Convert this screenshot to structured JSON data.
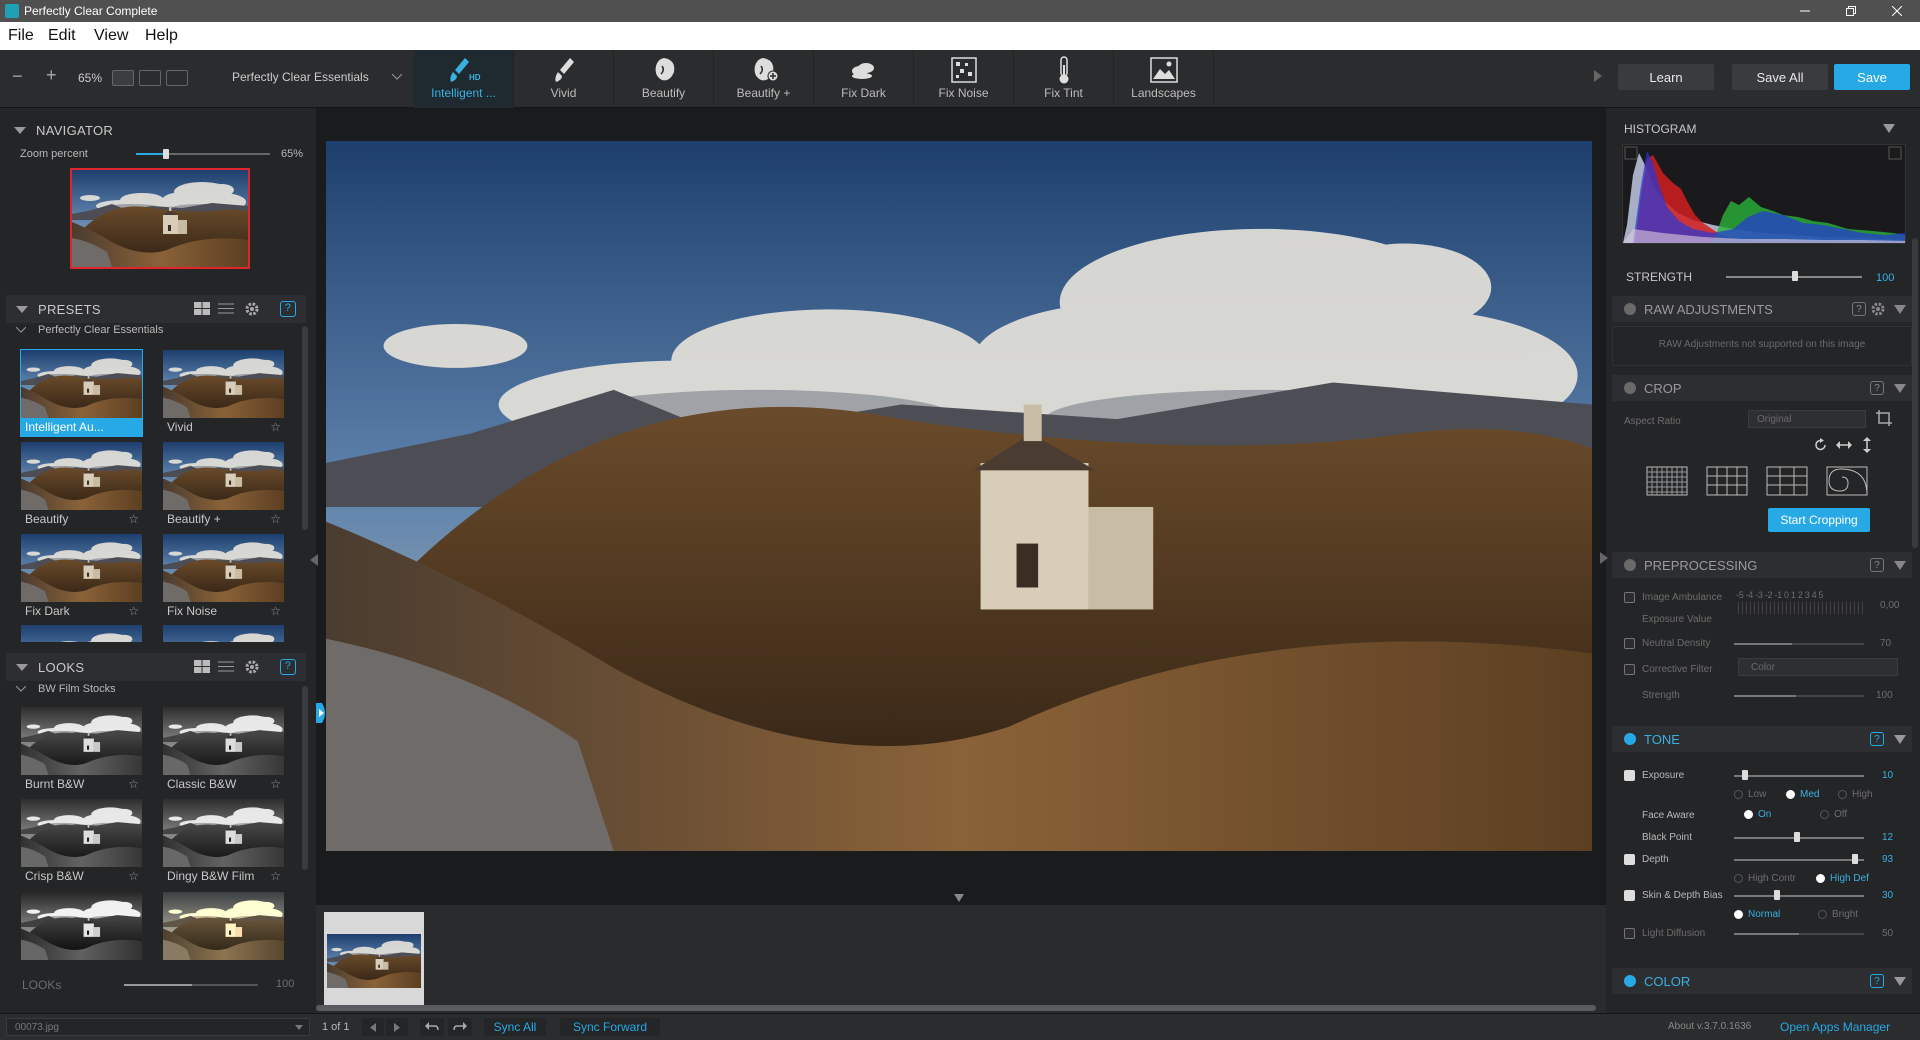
{
  "window": {
    "title": "Perfectly Clear Complete"
  },
  "menu": [
    "File",
    "Edit",
    "View",
    "Help"
  ],
  "toolbar": {
    "zoom": "65%",
    "preset_name": "Perfectly Clear Essentials",
    "tools": [
      {
        "label": "Intelligent ...",
        "icon": "brush-hd-icon",
        "active": true
      },
      {
        "label": "Vivid",
        "icon": "brush-icon"
      },
      {
        "label": "Beautify",
        "icon": "face-icon"
      },
      {
        "label": "Beautify +",
        "icon": "face-plus-icon"
      },
      {
        "label": "Fix Dark",
        "icon": "clouds-icon"
      },
      {
        "label": "Fix Noise",
        "icon": "noise-icon"
      },
      {
        "label": "Fix Tint",
        "icon": "thermometer-icon"
      },
      {
        "label": "Landscapes",
        "icon": "landscape-icon"
      }
    ],
    "learn": "Learn",
    "save_all": "Save All",
    "save": "Save"
  },
  "navigator": {
    "title": "NAVIGATOR",
    "zoom_label": "Zoom percent",
    "zoom_value": "65%",
    "zoom_fraction": 0.37
  },
  "presets": {
    "title": "PRESETS",
    "group": "Perfectly Clear Essentials",
    "items": [
      "Intelligent Au...",
      "Vivid",
      "Beautify",
      "Beautify +",
      "Fix Dark",
      "Fix Noise"
    ]
  },
  "looks": {
    "title": "LOOKS",
    "group": "BW Film Stocks",
    "items": [
      "Burnt B&W",
      "Classic B&W",
      "Crisp B&W",
      "Dingy B&W Film"
    ],
    "strength_label": "LOOKs",
    "strength_value": "100"
  },
  "histogram": {
    "title": "HISTOGRAM"
  },
  "strength": {
    "label": "STRENGTH",
    "value": "100",
    "fraction": 0.5
  },
  "raw": {
    "title": "RAW ADJUSTMENTS",
    "message": "RAW Adjustments not supported on this image"
  },
  "crop": {
    "title": "CROP",
    "aspect_label": "Aspect Ratio",
    "aspect_value": "Original",
    "start": "Start Cropping"
  },
  "preprocessing": {
    "title": "PREPROCESSING",
    "image_ambulance": "Image Ambulance",
    "ambulance_scale": "-5 -4 -3 -2 -1 0 1 2 3 4 5",
    "ambulance_value": "0,00",
    "exposure_value": "Exposure Value",
    "neutral_density": "Neutral Density",
    "neutral_value": "70",
    "neutral_fraction": 0.45,
    "corrective_filter": "Corrective Filter",
    "filter_value": "Color",
    "strength": "Strength",
    "strength_value": "100",
    "strength_fraction": 0.48
  },
  "tone": {
    "title": "TONE",
    "exposure": "Exposure",
    "exposure_value": "10",
    "exposure_fraction": 0.08,
    "low": "Low",
    "med": "Med",
    "high": "High",
    "face_aware": "Face Aware",
    "on": "On",
    "off": "Off",
    "black_point": "Black Point",
    "black_value": "12",
    "black_fraction": 0.47,
    "depth": "Depth",
    "depth_value": "93",
    "depth_fraction": 0.92,
    "high_contr": "High Contr",
    "high_def": "High Def",
    "skin_depth": "Skin & Depth Bias",
    "skin_value": "30",
    "skin_fraction": 0.31,
    "normal": "Normal",
    "bright": "Bright",
    "light_diffusion": "Light Diffusion",
    "light_value": "50",
    "light_fraction": 0.5
  },
  "color": {
    "title": "COLOR"
  },
  "status": {
    "file": "00073.jpg",
    "count": "1 of 1",
    "sync_all": "Sync All",
    "sync_forward": "Sync Forward",
    "about": "About v.3.7.0.1636",
    "open_apps": "Open Apps Manager"
  },
  "colors": {
    "accent": "#27a9e6",
    "panel": "#242527",
    "header": "#2d2e31"
  }
}
